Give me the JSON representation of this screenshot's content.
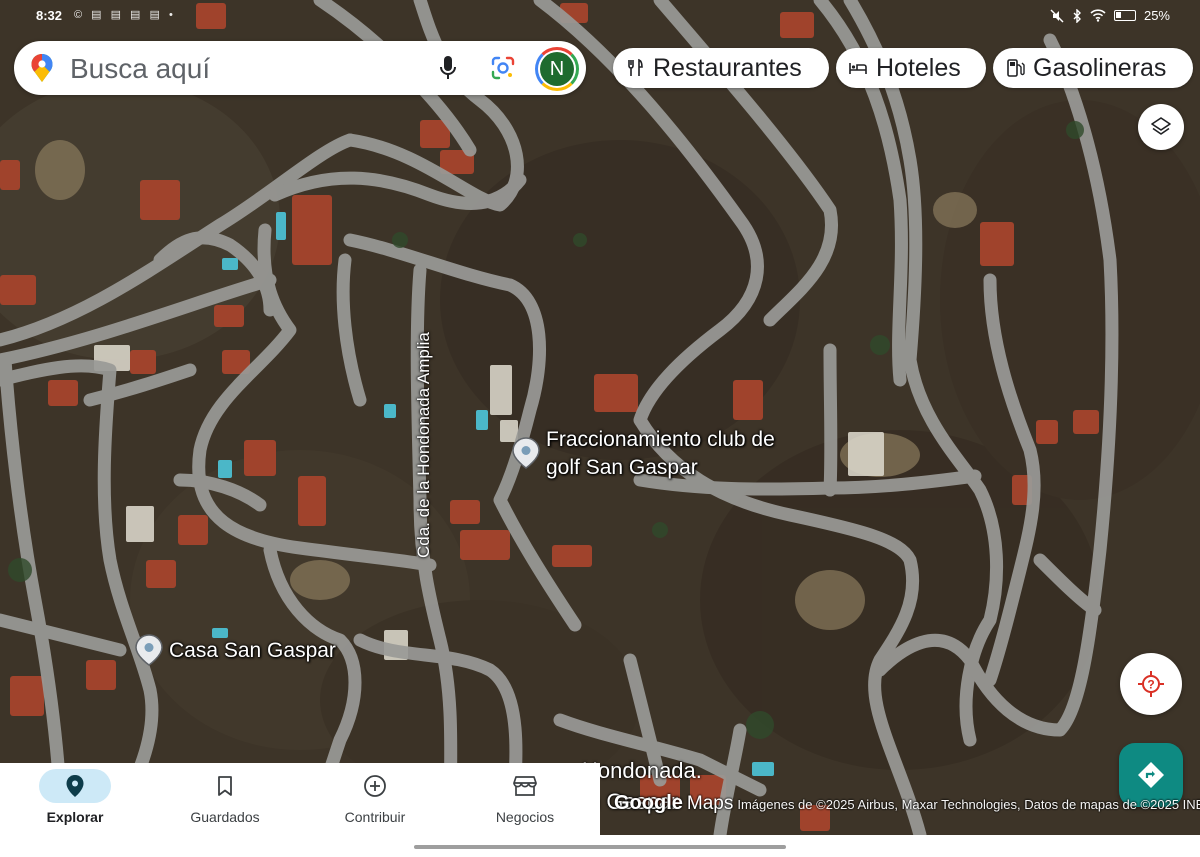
{
  "status_bar": {
    "time": "8:32",
    "left_icons": "© ▤ ▤ ▤ ▤ •",
    "battery": "25%"
  },
  "search": {
    "placeholder": "Busca aquí",
    "avatar_initial": "N"
  },
  "chips": [
    {
      "label": "Restaurantes",
      "icon": "fork-knife-icon"
    },
    {
      "label": "Hoteles",
      "icon": "bed-icon"
    },
    {
      "label": "Gasolineras",
      "icon": "gas-pump-icon"
    }
  ],
  "map": {
    "places": [
      {
        "name": "Fraccionamiento club de golf San Gaspar"
      },
      {
        "name": "Casa San Gaspar"
      }
    ],
    "streets": [
      {
        "name": "Cda. de la Hondonada Amplia"
      }
    ],
    "partial_label_1": "Hondonada.",
    "partial_label_2": "n Gaspar",
    "attribution": {
      "google": "Google",
      "maps": "Maps",
      "text": "Imágenes de ©2025 Airbus, Maxar Technologies, Datos de mapas de ©2025 INEGI"
    }
  },
  "nav": [
    {
      "label": "Explorar",
      "icon": "explore-pin-icon",
      "active": true
    },
    {
      "label": "Guardados",
      "icon": "bookmark-icon",
      "active": false
    },
    {
      "label": "Contribuir",
      "icon": "add-circle-icon",
      "active": false
    },
    {
      "label": "Negocios",
      "icon": "storefront-icon",
      "active": false
    }
  ],
  "colors": {
    "accent": "#0e8a82",
    "nav_active_pill": "#cde9f7",
    "terrain": "#3f3529",
    "road": "#9a9a97"
  }
}
